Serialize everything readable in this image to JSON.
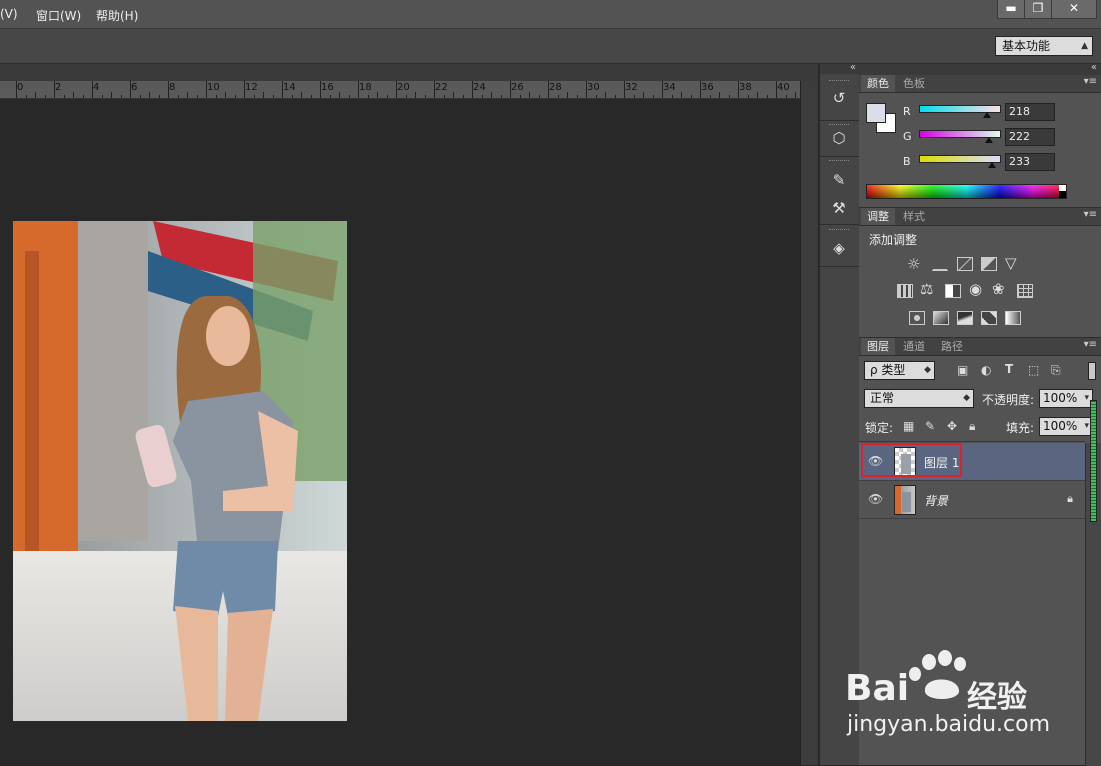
{
  "menubar": {
    "items": [
      "(V)",
      "窗口(W)",
      "帮助(H)"
    ],
    "window_buttons": [
      "▬",
      "❐",
      "✕"
    ]
  },
  "options_bar": {
    "workspace": "基本功能"
  },
  "ruler": {
    "labels": [
      "0",
      "2",
      "4",
      "6",
      "8",
      "10",
      "12",
      "14",
      "16",
      "18",
      "20",
      "22",
      "24",
      "26",
      "28",
      "30",
      "32",
      "34",
      "36",
      "38",
      "40"
    ]
  },
  "dock": {
    "collapse_label": "«",
    "icons": [
      "history-icon",
      "3d-icon",
      "brush-presets-icon",
      "tool-presets-icon",
      "cube-icon"
    ]
  },
  "panels_collapse_label": "«",
  "color_panel": {
    "tabs": [
      "颜色",
      "色板"
    ],
    "channels": [
      {
        "label": "R",
        "value": "218",
        "fraction": 0.855
      },
      {
        "label": "G",
        "value": "222",
        "fraction": 0.871
      },
      {
        "label": "B",
        "value": "233",
        "fraction": 0.914
      }
    ],
    "foreground": "#dadee9"
  },
  "adjustments_panel": {
    "tabs": [
      "调整",
      "样式"
    ],
    "title": "添加调整"
  },
  "layers_panel": {
    "tabs": [
      "图层",
      "通道",
      "路径"
    ],
    "filter_kind": "ρ 类型",
    "blend_mode": "正常",
    "opacity_label": "不透明度:",
    "opacity_value": "100%",
    "lock_label": "锁定:",
    "fill_label": "填充:",
    "fill_value": "100%",
    "layers": [
      {
        "name": "图层 1",
        "selected": true
      },
      {
        "name": "背景",
        "selected": false,
        "locked": true
      }
    ]
  },
  "watermark": {
    "brand_left": "Bai",
    "brand_right": "经验",
    "url": "jingyan.baidu.com"
  }
}
